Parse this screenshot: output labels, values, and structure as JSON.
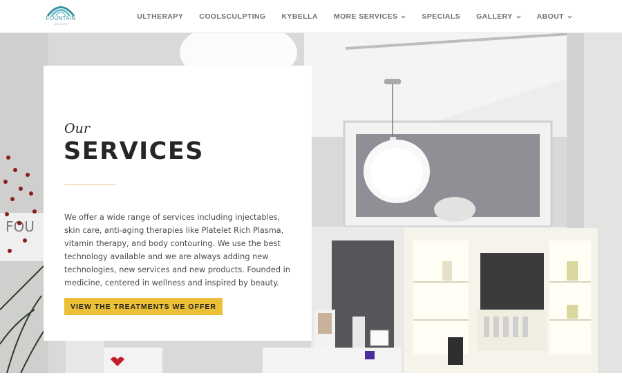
{
  "brand": {
    "name": "FOUNTAIN",
    "tagline": "MEDSPA",
    "color": "#3a8fa3"
  },
  "nav": {
    "items": [
      {
        "label": "ULTHERAPY",
        "has_dropdown": false
      },
      {
        "label": "COOLSCULPTING",
        "has_dropdown": false
      },
      {
        "label": "KYBELLA",
        "has_dropdown": false
      },
      {
        "label": "MORE SERVICES",
        "has_dropdown": true
      },
      {
        "label": "SPECIALS",
        "has_dropdown": false
      },
      {
        "label": "GALLERY",
        "has_dropdown": true
      },
      {
        "label": "ABOUT",
        "has_dropdown": true
      }
    ]
  },
  "hero": {
    "kicker": "Our",
    "title": "SERVICES",
    "body": "We offer a wide range of services including injectables, skin care, anti-aging therapies like Platelet Rich Plasma, vitamin therapy, and body contouring. We use the best technology available and we are always adding new technologies, new services and new products. Founded in medicine, centered in wellness and inspired by beauty.",
    "cta_label": "VIEW THE TREATMENTS WE OFFER"
  },
  "colors": {
    "accent": "#ebc036",
    "divider": "#e4c77a",
    "nav_text": "#6f6f6f"
  }
}
